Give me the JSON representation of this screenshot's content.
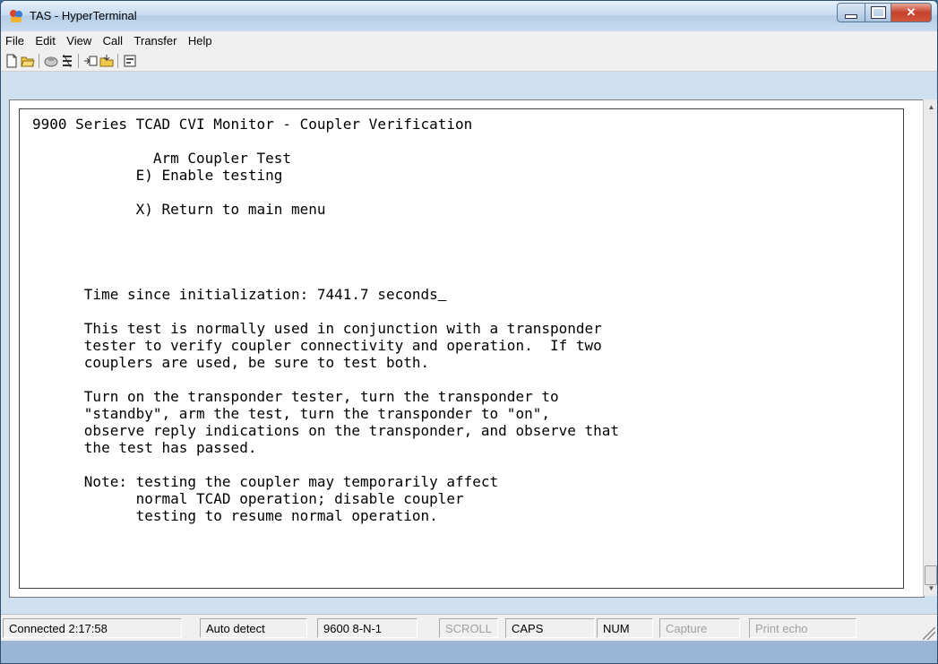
{
  "window": {
    "title": "TAS - HyperTerminal"
  },
  "menu": [
    "File",
    "Edit",
    "View",
    "Call",
    "Transfer",
    "Help"
  ],
  "toolbar": [
    "new-icon",
    "open-icon",
    "connect-icon",
    "disconnect-icon",
    "send-icon",
    "receive-icon",
    "properties-icon"
  ],
  "terminal": {
    "lines": [
      "9900 Series TCAD CVI Monitor - Coupler Verification",
      "",
      "              Arm Coupler Test",
      "            E) Enable testing",
      "",
      "            X) Return to main menu",
      "",
      "",
      "",
      "",
      "      Time since initialization: 7441.7 seconds",
      "",
      "      This test is normally used in conjunction with a transponder",
      "      tester to verify coupler connectivity and operation.  If two",
      "      couplers are used, be sure to test both.",
      "",
      "      Turn on the transponder tester, turn the transponder to",
      "      \"standby\", arm the test, turn the transponder to \"on\",",
      "      observe reply indications on the transponder, and observe that",
      "      the test has passed.",
      "",
      "      Note: testing the coupler may temporarily affect",
      "            normal TCAD operation; disable coupler",
      "            testing to resume normal operation."
    ],
    "cursor_line": 10
  },
  "status": {
    "connected": "Connected 2:17:58",
    "detect": "Auto detect",
    "settings": "9600 8-N-1",
    "scroll": "SCROLL",
    "caps": "CAPS",
    "num": "NUM",
    "capture": "Capture",
    "print_echo": "Print echo"
  }
}
